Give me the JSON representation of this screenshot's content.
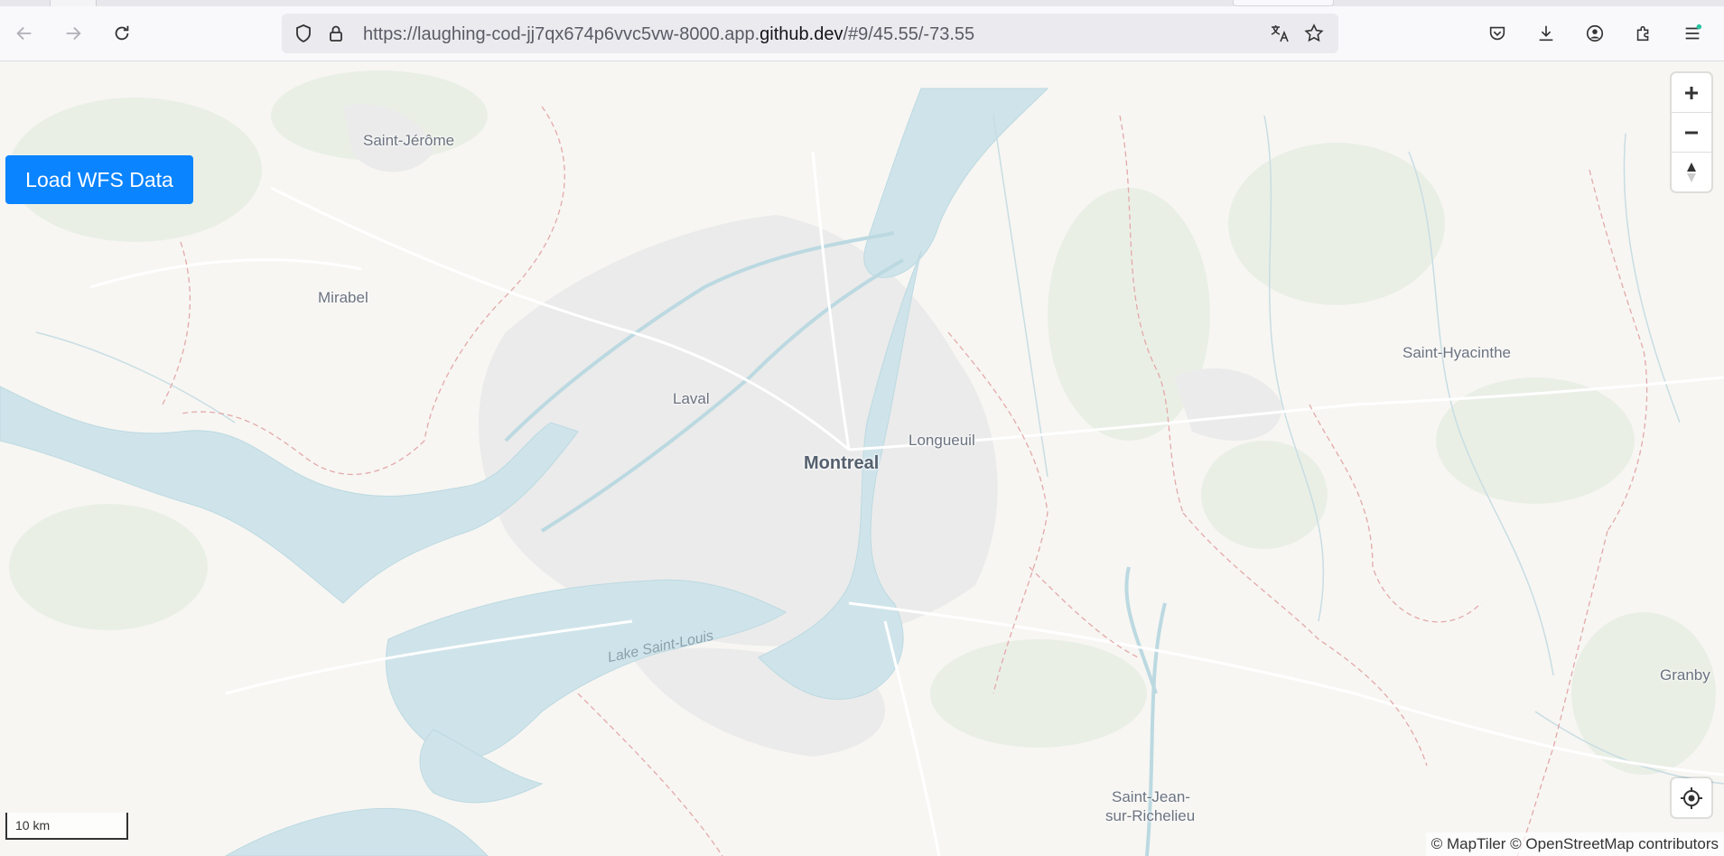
{
  "browser": {
    "url_prefix": "https://laughing-cod-jj7qx674p6vvc5vw-8000.app.",
    "url_domain": "github.dev",
    "url_suffix": "/#9/45.55/-73.55",
    "icons": [
      "back-icon",
      "forward-icon",
      "reload-icon",
      "shield-icon",
      "lock-icon",
      "translate-icon",
      "bookmark-star-icon",
      "pocket-icon",
      "download-icon",
      "account-icon",
      "extensions-icon",
      "menu-icon"
    ]
  },
  "map": {
    "load_button_label": "Load WFS Data",
    "zoom_in_label": "+",
    "zoom_out_label": "−",
    "scale_label": "10 km",
    "attribution": "© MapTiler © OpenStreetMap contributors",
    "places": {
      "saint_jerome": "Saint-Jérôme",
      "mirabel": "Mirabel",
      "laval": "Laval",
      "montreal": "Montreal",
      "longueuil": "Longueuil",
      "saint_hyacinthe": "Saint-Hyacinthe",
      "granby": "Granby",
      "saint_jean_1": "Saint-Jean-",
      "saint_jean_2": "sur-Richelieu",
      "lake_saint_louis": "Lake Saint-Louis"
    },
    "colors": {
      "water": "#cfe4ea",
      "land": "#f7f6f3",
      "urban": "#e8e8e8",
      "boundary": "#e3a3a3",
      "button": "#0a84ff"
    }
  }
}
